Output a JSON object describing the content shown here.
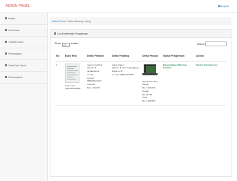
{
  "app": {
    "brand": "ADMIN PANEL",
    "logout": "Logout"
  },
  "sidebar": {
    "items": [
      {
        "label": "Master",
        "icon": "grid-icon",
        "has_arrow": true
      },
      {
        "label": "Konfirmasi",
        "icon": "list-icon",
        "has_arrow": true
      },
      {
        "label": "Transfer Dana",
        "icon": "transfer-icon",
        "has_arrow": false
      },
      {
        "label": "Pembayaran",
        "icon": "document-icon",
        "has_arrow": false
      },
      {
        "label": "Ganti Kata Sandi",
        "icon": "settings-icon",
        "has_arrow": false
      },
      {
        "label": "Sembunyikan",
        "icon": "user-icon",
        "has_arrow": false
      }
    ]
  },
  "breadcrumb": {
    "root": "Admin Panel",
    "sep": "/",
    "current": "Status Barang Lelang"
  },
  "panel": {
    "title": "List Konfirmasi Pengiriman"
  },
  "controls": {
    "show_prefix": "Show",
    "show_value": "10",
    "show_suffix": "entries",
    "search_label": "Search:"
  },
  "table": {
    "headers": [
      "No",
      "Bukti Resi",
      "Detail Pembeli",
      "Detail Pelelang",
      "Detail Produk",
      "Status Pengiriman",
      "Action"
    ],
    "rows": [
      {
        "no": "1",
        "resi_label": "nomor resi:",
        "resi_number": "pdg1235345456",
        "pembeli": [
          "nama: Ivry Rizal",
          "alamat: Jl. Jayakusuma",
          "no. 55",
          "no.telp:",
          "085624621234",
          "Transfer:",
          "Rp.1.446.000"
        ],
        "pelelang": [
          "nama: Niger",
          "alamat: Jl. Cirt. Gatanggung",
          "Raya no 47",
          "no.telp: 089614012596"
        ],
        "produk": [
          "laptop asus 234",
          "Harga:",
          "Rp.1.400.000",
          "Ongkir:",
          "Rp.16.000",
          "Total:",
          "Rp.1.446.000"
        ],
        "status": "Barang Belum Diterima Pembeli",
        "action": "Sudah Terkonfirmasi"
      }
    ]
  }
}
